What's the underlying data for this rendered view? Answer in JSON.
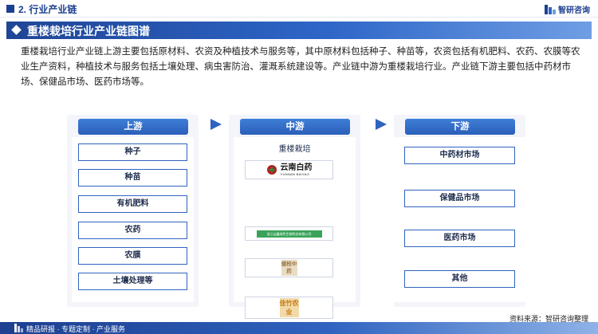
{
  "header": {
    "section_title": "2. 行业产业链",
    "brand_name": "智研咨询"
  },
  "banner": {
    "title": "重楼栽培行业产业链图谱"
  },
  "description": "重楼栽培行业产业链上游主要包括原材料、农资及种植技术与服务等，其中原材料包括种子、种苗等，农资包括有机肥料、农药、农膜等农业生产资料，种植技术与服务包括土壤处理、病虫害防治、灌溉系统建设等。产业链中游为重楼栽培行业。产业链下游主要包括中药材市场、保健品市场、医药市场等。",
  "upstream": {
    "heading": "上游",
    "items": [
      "种子",
      "种苗",
      "有机肥料",
      "农药",
      "农膜",
      "土壤处理等"
    ]
  },
  "midstream": {
    "heading": "中游",
    "label": "重楼栽培",
    "logos": [
      {
        "icon": "yunnan-baiyao-logo",
        "text_cn": "云南白药",
        "text_en": "YUNNAN BAIYAO"
      },
      {
        "icon": "green-company-logo",
        "text": "浙江云鑫绿色生物科技有限公司"
      },
      {
        "icon": "jiankang-zhongyao-logo",
        "text": "健枝中药"
      },
      {
        "icon": "jiazhu-nongye-logo",
        "text": "佳竹农业"
      }
    ]
  },
  "downstream": {
    "heading": "下游",
    "items": [
      "中药材市场",
      "保健品市场",
      "医药市场",
      "其他"
    ]
  },
  "footer": {
    "source": "资料来源：智研咨询整理",
    "bar_text": "精品研报 · 专题定制 · 产业服务"
  },
  "colors": {
    "primary": "#1d3f8f",
    "accent": "#2f63bf"
  }
}
